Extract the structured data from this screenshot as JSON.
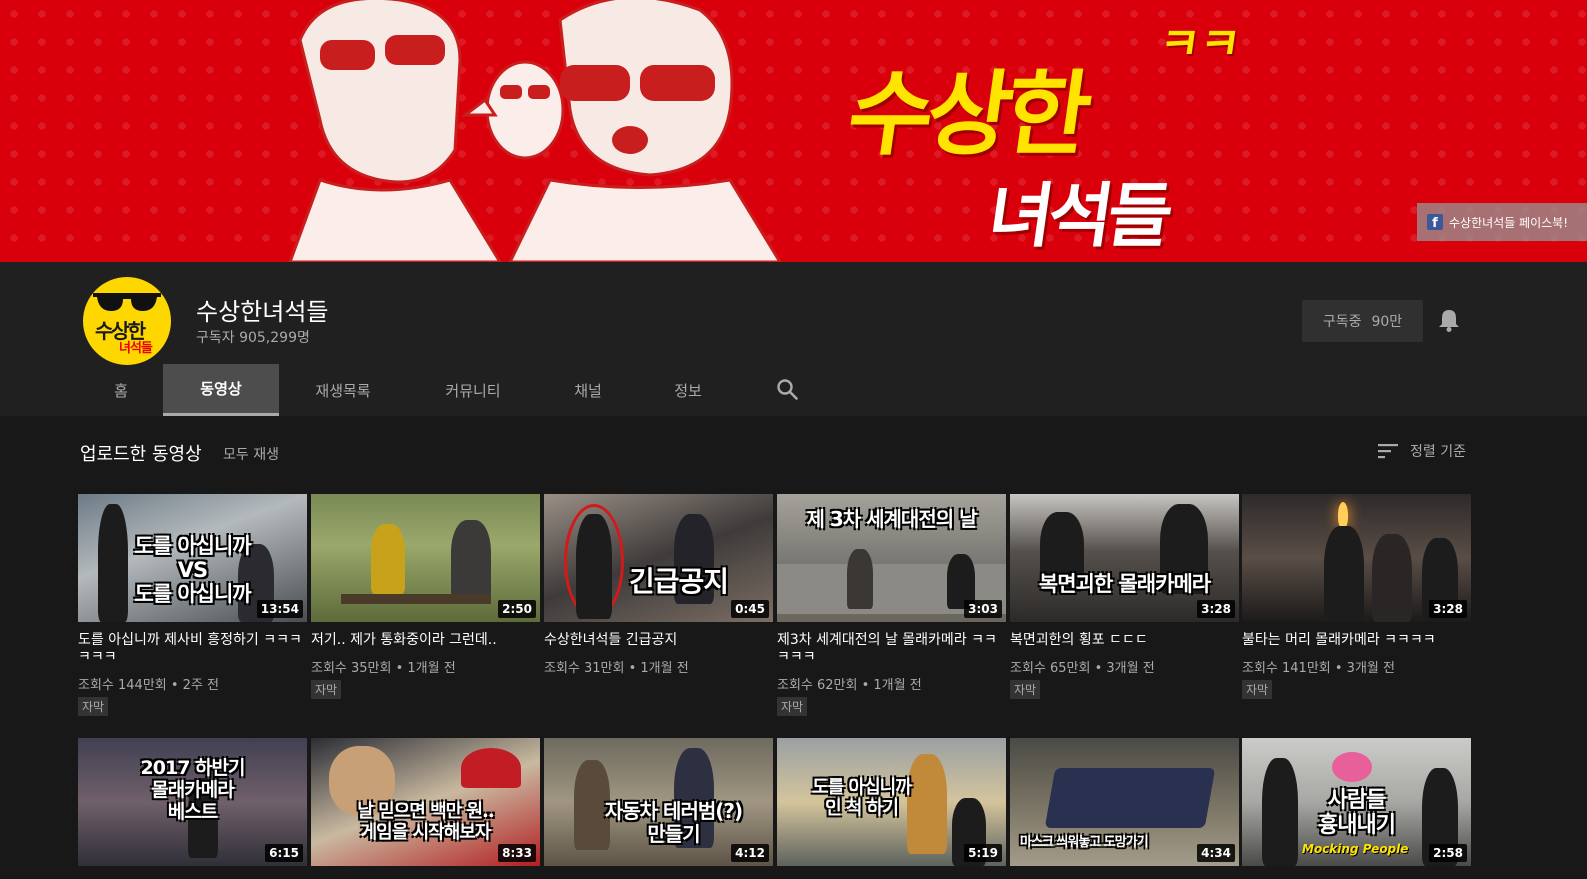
{
  "banner": {
    "title": "수상한",
    "title_suffix": "ㅋㅋ",
    "subtitle": "녀석들",
    "facebook_link": "수상한녀석들 페이스북!",
    "facebook_icon": "facebook-icon"
  },
  "channel": {
    "name": "수상한녀석들",
    "subscribers": "구독자 905,299명",
    "avatar_text_top": "수상한",
    "avatar_text_bottom": "녀석들",
    "subscribe_label": "구독중",
    "subscribe_count": "90만"
  },
  "tabs": [
    {
      "label": "홈"
    },
    {
      "label": "동영상",
      "active": true
    },
    {
      "label": "재생목록"
    },
    {
      "label": "커뮤니티"
    },
    {
      "label": "채널"
    },
    {
      "label": "정보"
    }
  ],
  "section": {
    "title": "업로드한 동영상",
    "play_all": "모두 재생",
    "sort_label": "정렬 기준"
  },
  "videos": [
    {
      "thumb_text": "도를 아십니까\nVS\n도를 아십니까",
      "duration": "13:54",
      "title": "도를 아십니까 제사비 흥정하기 ㅋㅋㅋㅋㅋㅋ",
      "meta": "조회수 144만회 • 2주 전",
      "cc": "자막"
    },
    {
      "thumb_text": "",
      "duration": "2:50",
      "title": "저기.. 제가 통화중이라 그런데..",
      "meta": "조회수 35만회 • 1개월 전",
      "cc": "자막"
    },
    {
      "thumb_text": "긴급공지",
      "duration": "0:45",
      "title": "수상한녀석들 긴급공지",
      "meta": "조회수 31만회 • 1개월 전",
      "cc": ""
    },
    {
      "thumb_text": "제 3차 세계대전의 날",
      "duration": "3:03",
      "title": "제3차 세계대전의 날 몰래카메라 ㅋㅋㅋㅋㅋ",
      "meta": "조회수 62만회 • 1개월 전",
      "cc": "자막"
    },
    {
      "thumb_text": "복면괴한 몰래카메라",
      "duration": "3:28",
      "title": "복면괴한의 횡포 ㄷㄷㄷ",
      "meta": "조회수 65만회 • 3개월 전",
      "cc": "자막"
    },
    {
      "thumb_text": "",
      "duration": "3:28",
      "title": "불타는 머리 몰래카메라 ㅋㅋㅋㅋ",
      "meta": "조회수 141만회 • 3개월 전",
      "cc": "자막"
    },
    {
      "thumb_text": "2017 하반기\n몰래카메라\n베스트",
      "duration": "6:15",
      "title": "",
      "meta": "",
      "cc": ""
    },
    {
      "thumb_text": "날 믿으면 백만 원..\n게임을 시작해보자",
      "duration": "8:33",
      "title": "",
      "meta": "",
      "cc": ""
    },
    {
      "thumb_text": "자동차 테러범(?)\n만들기",
      "duration": "4:12",
      "title": "",
      "meta": "",
      "cc": ""
    },
    {
      "thumb_text": "도를 아십니까\n인 척 하기",
      "duration": "5:19",
      "title": "",
      "meta": "",
      "cc": ""
    },
    {
      "thumb_text": "마스크 씌워놓고 도망가기",
      "duration": "4:34",
      "title": "",
      "meta": "",
      "cc": ""
    },
    {
      "thumb_text": "사람들\n흉내내기",
      "duration": "2:58",
      "title": "",
      "meta": "",
      "cc": "",
      "thumb_sub": "Mocking People"
    }
  ],
  "colors": {
    "banner_red": "#d9000c",
    "title_yellow": "#ffe400",
    "background": "#181818",
    "header_bg": "#202020"
  },
  "icons": {
    "bell": "bell-icon",
    "search": "search-icon",
    "sort": "sort-icon"
  }
}
